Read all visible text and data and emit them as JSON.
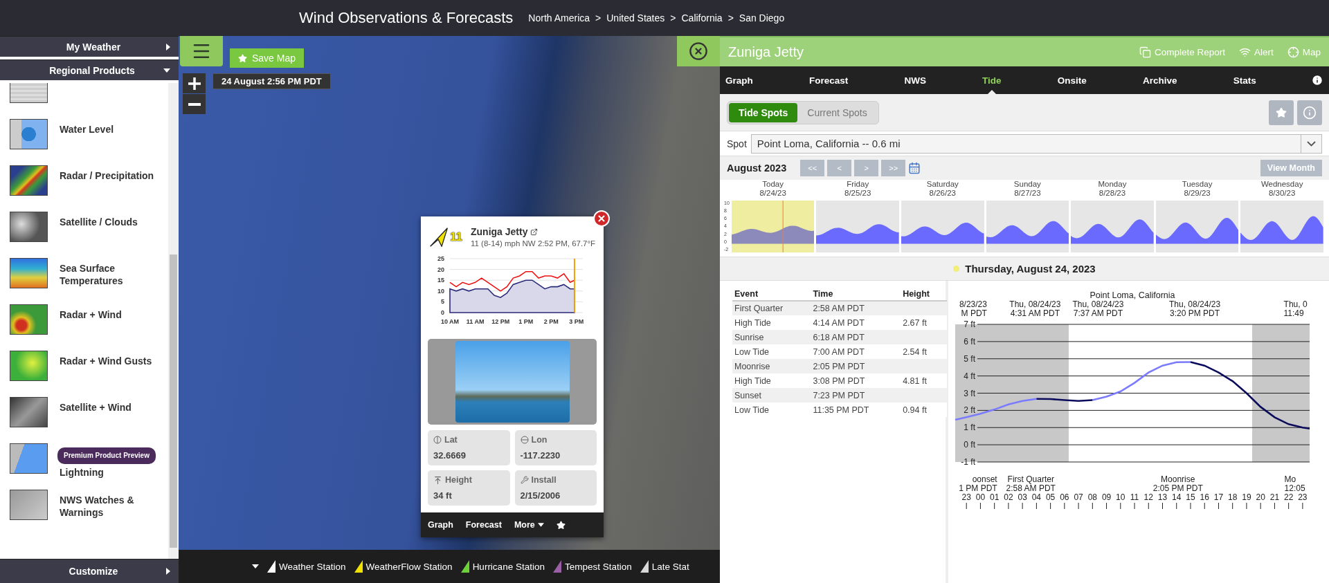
{
  "header": {
    "title": "Wind Observations & Forecasts",
    "breadcrumbs": [
      "North America",
      "United States",
      "California",
      "San Diego"
    ],
    "separator": ">"
  },
  "sidebar": {
    "sections": [
      {
        "label": "My Weather",
        "expanded": false
      },
      {
        "label": "Regional Products",
        "expanded": true
      }
    ],
    "items": [
      {
        "kind": "bubble"
      },
      {
        "kind": "water",
        "label": "Water Level"
      },
      {
        "kind": "radar",
        "label": "Radar / Precipitation"
      },
      {
        "kind": "satellite",
        "label": "Satellite / Clouds"
      },
      {
        "kind": "sst",
        "label": "Sea Surface Temperatures"
      },
      {
        "kind": "radar-wind",
        "label": "Radar + Wind"
      },
      {
        "kind": "gusts",
        "label": "Radar + Wind Gusts"
      },
      {
        "kind": "sat-wind",
        "label": "Satellite + Wind"
      },
      {
        "kind": "lightning",
        "label": "Lightning",
        "badge": "Premium Product Preview"
      },
      {
        "kind": "nws",
        "label": "NWS Watches & Warnings"
      }
    ],
    "footer": {
      "label": "Customize",
      "expanded": false
    }
  },
  "map": {
    "save_label": "Save Map",
    "timestamp": "24 August 2:56 PM PDT",
    "legend": [
      {
        "label": "Weather Station",
        "color": "#ffffff"
      },
      {
        "label": "WeatherFlow Station",
        "color": "#f2e200"
      },
      {
        "label": "Hurricane Station",
        "color": "#6fd13a"
      },
      {
        "label": "Tempest Station",
        "color": "#9b5fa5"
      },
      {
        "label": "Late Stat",
        "color": "#d8d8d8"
      }
    ]
  },
  "popup": {
    "speed": "11",
    "station": "Zuniga Jetty",
    "summary": "11 (8-14) mph NW 2:52 PM, 67.7°F",
    "chart_times": [
      "10 AM",
      "11 AM",
      "12 PM",
      "1 PM",
      "2 PM",
      "3 PM"
    ],
    "chart_data": {
      "type": "line",
      "grid": true,
      "series": [
        {
          "color": "#ee1111",
          "values": [
            14,
            12,
            14,
            13,
            14,
            16,
            14,
            12,
            10,
            12,
            16,
            17,
            19,
            19,
            16,
            17,
            17,
            16,
            18,
            14,
            15
          ]
        },
        {
          "type": "area",
          "color": "#2a2a7a",
          "values": [
            11,
            10,
            11,
            10,
            11,
            11,
            11,
            8,
            7,
            9,
            13,
            14,
            15,
            15,
            13,
            11,
            12,
            12,
            13,
            11,
            11
          ]
        }
      ],
      "ylim": [
        0,
        25
      ],
      "yticks": [
        0,
        5,
        10,
        15,
        20,
        25
      ]
    },
    "details": [
      {
        "kind": "lat",
        "label": "Lat",
        "value": "32.6669"
      },
      {
        "kind": "lon",
        "label": "Lon",
        "value": "-117.2230"
      },
      {
        "kind": "height",
        "label": "Height",
        "value": "34 ft"
      },
      {
        "kind": "install",
        "label": "Install",
        "value": "2/15/2006"
      }
    ],
    "footer": [
      {
        "kind": "link",
        "label": "Graph"
      },
      {
        "kind": "link",
        "label": "Forecast"
      },
      {
        "kind": "menu",
        "label": "More"
      },
      {
        "kind": "star"
      }
    ]
  },
  "station_panel": {
    "title": "Zuniga Jetty",
    "actions": [
      {
        "kind": "report",
        "label": "Complete Report"
      },
      {
        "kind": "alert",
        "label": "Alert"
      },
      {
        "kind": "map",
        "label": "Map"
      }
    ],
    "tabs": [
      {
        "label": "Graph",
        "selected": false
      },
      {
        "label": "Forecast",
        "selected": false
      },
      {
        "label": "NWS",
        "selected": false
      },
      {
        "label": "Tide",
        "selected": true
      },
      {
        "label": "Onsite",
        "selected": false
      },
      {
        "label": "Archive",
        "selected": false
      },
      {
        "label": "Stats",
        "selected": false
      }
    ],
    "spot_types": [
      {
        "label": "Tide Spots",
        "selected": true
      },
      {
        "label": "Current Spots",
        "selected": false
      }
    ],
    "spot": {
      "label": "Spot",
      "value": "Point Loma, California -- 0.6 mi"
    },
    "month": {
      "label": "August 2023",
      "nav": [
        "<<",
        "<",
        ">",
        ">>"
      ],
      "view_button": "View Month"
    },
    "week": {
      "axis_labels": [
        "10",
        "8",
        "6",
        "4",
        "2",
        "0",
        "-2"
      ],
      "days": [
        {
          "day": "Today",
          "date": "8/24/23",
          "selected": true
        },
        {
          "day": "Friday",
          "date": "8/25/23",
          "selected": false
        },
        {
          "day": "Saturday",
          "date": "8/26/23",
          "selected": false
        },
        {
          "day": "Sunday",
          "date": "8/27/23",
          "selected": false
        },
        {
          "day": "Monday",
          "date": "8/28/23",
          "selected": false
        },
        {
          "day": "Tuesday",
          "date": "8/29/23",
          "selected": false
        },
        {
          "day": "Wednesday",
          "date": "8/30/23",
          "selected": false
        }
      ]
    },
    "day_title": "Thursday, August 24, 2023",
    "events": {
      "columns": [
        "Event",
        "Time",
        "Height"
      ],
      "rows": [
        {
          "event": "First Quarter",
          "time": "2:58 AM PDT"
        },
        {
          "event": "High Tide",
          "time": "4:14 AM PDT",
          "height": "2.67 ft"
        },
        {
          "event": "Sunrise",
          "time": "6:18 AM PDT"
        },
        {
          "event": "Low Tide",
          "time": "7:00 AM PDT",
          "height": "2.54 ft"
        },
        {
          "event": "Moonrise",
          "time": "2:05 PM PDT"
        },
        {
          "event": "High Tide",
          "time": "3:08 PM PDT",
          "height": "4.81 ft"
        },
        {
          "event": "Sunset",
          "time": "7:23 PM PDT"
        },
        {
          "event": "Low Tide",
          "time": "11:35 PM PDT",
          "height": "0.94 ft"
        }
      ]
    },
    "tide_chart": {
      "top_labels": [
        [
          "8/23/23",
          "M PDT"
        ],
        [
          "Thu, 08/24/23",
          "4:31 AM PDT"
        ],
        [
          "Thu, 08/24/23",
          "7:37 AM PDT"
        ],
        [
          "Thu, 08/24/23",
          "3:20 PM PDT"
        ],
        [
          "Thu, 0",
          "11:49"
        ]
      ],
      "bottom_labels": [
        [
          "oonset",
          "1 PM PDT"
        ],
        [
          "First Quarter",
          "2:58 AM PDT"
        ],
        [
          "Moonrise",
          "2:05 PM PDT"
        ],
        [
          "Mo",
          "12:05"
        ]
      ],
      "prev_day_hour": "23",
      "chart_data": {
        "type": "line",
        "title": "Point Loma, California",
        "grid": true,
        "x": [
          -1.8,
          -1,
          0,
          1,
          2,
          3,
          4,
          5,
          6,
          7,
          8,
          9,
          10,
          11,
          12,
          13,
          14,
          15,
          16,
          17,
          18,
          19,
          20,
          21,
          22,
          23,
          23.5
        ],
        "series": [
          {
            "color": "#7b7bff",
            "values": [
              1.45,
              1.6,
              1.8,
              2.05,
              2.35,
              2.55,
              2.67,
              null,
              null,
              null,
              2.6,
              2.8,
              3.1,
              3.6,
              4.2,
              4.6,
              4.8,
              4.81,
              null,
              null,
              null,
              null,
              null,
              null,
              null,
              null,
              null
            ]
          },
          {
            "color": "#0b0b5c",
            "values": [
              null,
              null,
              null,
              null,
              null,
              null,
              2.67,
              2.66,
              2.6,
              2.55,
              2.6,
              null,
              null,
              null,
              null,
              null,
              null,
              4.81,
              4.6,
              4.2,
              3.7,
              3.0,
              2.2,
              1.6,
              1.2,
              1.0,
              0.94
            ]
          }
        ],
        "xlim": [
          -1.8,
          23.5
        ],
        "ylim": [
          -1,
          7
        ],
        "yticks": [
          {
            "value": -1,
            "label": "-1 ft"
          },
          {
            "value": 0,
            "label": "0 ft"
          },
          {
            "value": 1,
            "label": "1 ft"
          },
          {
            "value": 2,
            "label": "2 ft"
          },
          {
            "value": 3,
            "label": "3 ft"
          },
          {
            "value": 4,
            "label": "4 ft"
          },
          {
            "value": 5,
            "label": "5 ft"
          },
          {
            "value": 6,
            "label": "6 ft"
          },
          {
            "value": 7,
            "label": "7 ft"
          }
        ],
        "xticks": [
          {
            "value": 0,
            "label": "00"
          },
          {
            "value": 1,
            "label": "01"
          },
          {
            "value": 2,
            "label": "02"
          },
          {
            "value": 3,
            "label": "03"
          },
          {
            "value": 4,
            "label": "04"
          },
          {
            "value": 5,
            "label": "05"
          },
          {
            "value": 6,
            "label": "06"
          },
          {
            "value": 7,
            "label": "07"
          },
          {
            "value": 8,
            "label": "08"
          },
          {
            "value": 9,
            "label": "09"
          },
          {
            "value": 10,
            "label": "10"
          },
          {
            "value": 11,
            "label": "11"
          },
          {
            "value": 12,
            "label": "12"
          },
          {
            "value": 13,
            "label": "13"
          },
          {
            "value": 14,
            "label": "14"
          },
          {
            "value": 15,
            "label": "15"
          },
          {
            "value": 16,
            "label": "16"
          },
          {
            "value": 17,
            "label": "17"
          },
          {
            "value": 18,
            "label": "18"
          },
          {
            "value": 19,
            "label": "19"
          },
          {
            "value": 20,
            "label": "20"
          },
          {
            "value": 21,
            "label": "21"
          },
          {
            "value": 22,
            "label": "22"
          },
          {
            "value": 23,
            "label": "23"
          }
        ]
      }
    }
  }
}
